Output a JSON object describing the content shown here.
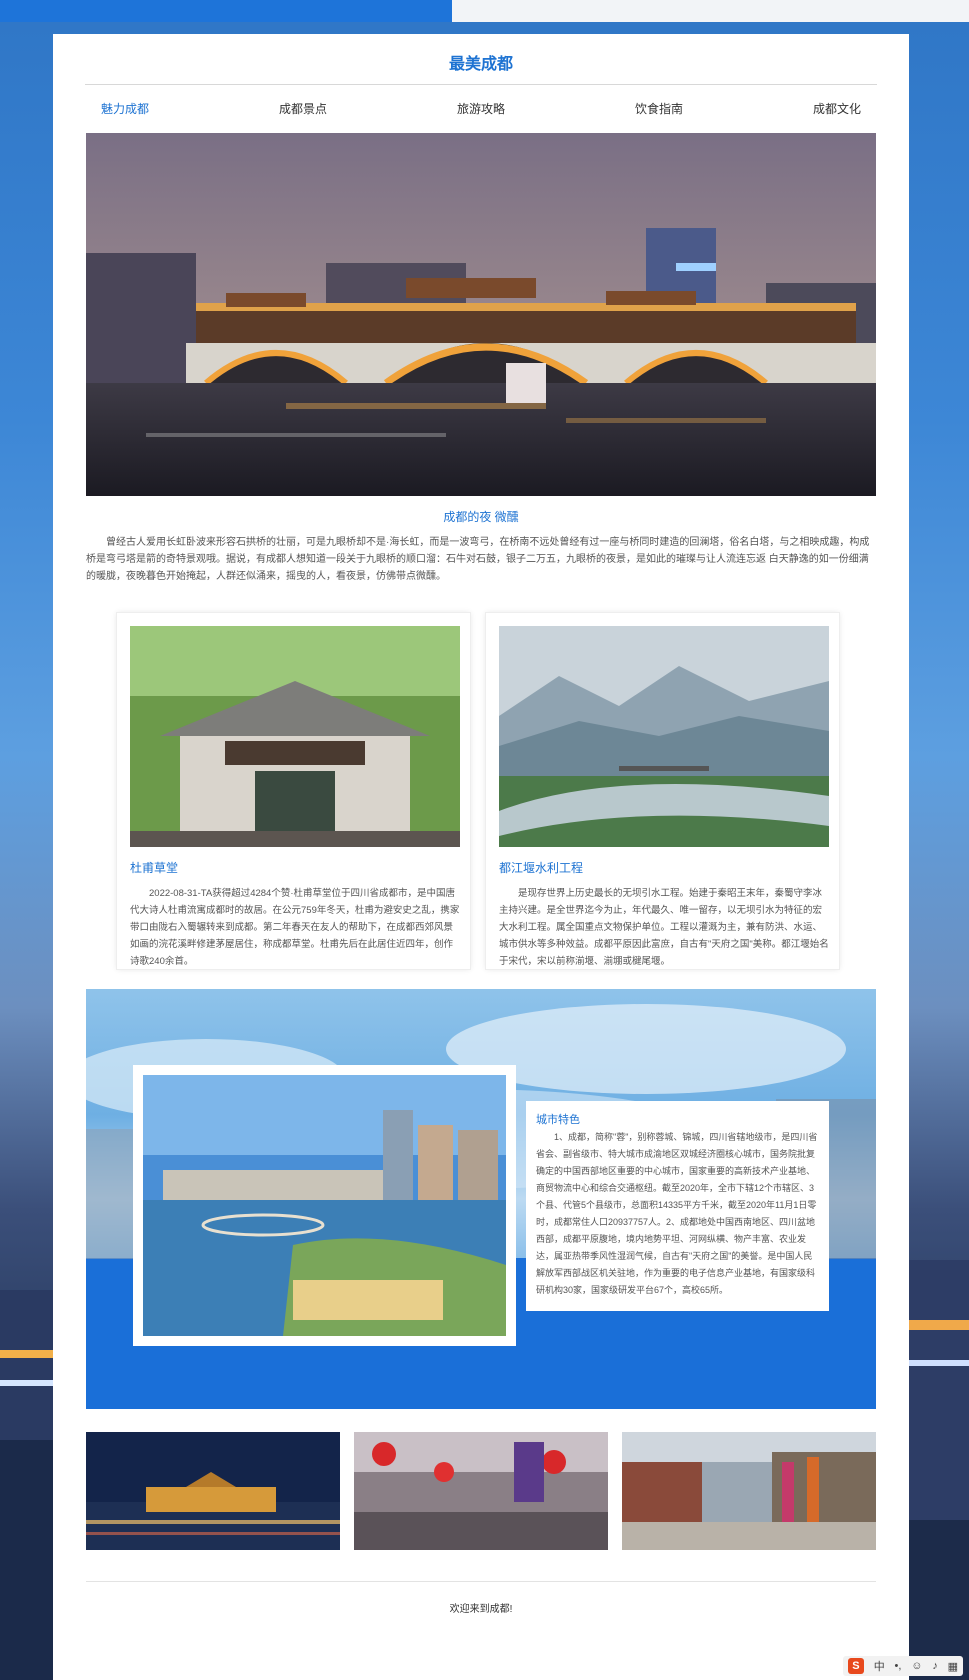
{
  "site": {
    "title": "最美成都"
  },
  "nav": {
    "items": [
      "魅力成都",
      "成都景点",
      "旅游攻略",
      "饮食指南",
      "成都文化"
    ]
  },
  "hero": {
    "caption": "成都的夜 微醺",
    "text": "曾经古人爱用长虹卧波来形容石拱桥的壮丽，可是九眼桥却不是·海长虹，而是一波弯弓，在桥南不远处曾经有过一座与桥同时建造的回澜塔，俗名白塔，与之相映成趣，构成桥是弯弓塔是箭的奇特景观哦。据说，有成都人想知道一段关于九眼桥的顺口溜：石牛对石鼓，银子二万五，九眼桥的夜景，是如此的璀璨与让人流连忘返 白天静逸的如一份细满的暖胧，夜晚暮色开始掩起，人群还似涌来，摇曳的人，看夜景，仿佛带点微醺。"
  },
  "cards": [
    {
      "title": "杜甫草堂",
      "text": "2022-08-31-TA获得超过4284个赞·杜甫草堂位于四川省成都市，是中国唐代大诗人杜甫流寓成都时的故居。在公元759年冬天，杜甫为避安史之乱，携家带口由陇右入蜀辗转来到成都。第二年春天在友人的帮助下，在成都西郊风景如画的浣花溪畔修建茅屋居住，称成都草堂。杜甫先后在此居住近四年，创作诗歌240余首。"
    },
    {
      "title": "都江堰水利工程",
      "text": "是现存世界上历史最长的无坝引水工程。始建于秦昭王末年，秦蜀守李冰主持兴建。是全世界迄今为止，年代最久、唯一留存，以无坝引水为特征的宏大水利工程。属全国重点文物保护单位。工程以灌溉为主，兼有防洪、水运、城市供水等多种效益。成都平原因此富庶，自古有\"天府之国\"美称。都江堰始名于宋代，宋以前称湔堰、湔堋或楗尾堰。"
    }
  ],
  "feature": {
    "title": "城市特色",
    "text": "1、成都，简称\"蓉\"，别称蓉城、锦城，四川省辖地级市，是四川省省会、副省级市、特大城市成渝地区双城经济圈核心城市，国务院批复确定的中国西部地区重要的中心城市，国家重要的高新技术产业基地、商贸物流中心和综合交通枢纽。截至2020年，全市下辖12个市辖区、3个县、代管5个县级市，总面积14335平方千米，截至2020年11月1日零时，成都常住人口20937757人。2、成都地处中国西南地区、四川盆地西部，成都平原腹地，境内地势平坦、河网纵横、物产丰富、农业发达，属亚热带季风性湿润气候，自古有\"天府之国\"的美誉。是中国人民解放军西部战区机关驻地，作为重要的电子信息产业基地，有国家级科研机构30家，国家级研发平台67个，高校65所。"
  },
  "footer": {
    "text": "欢迎来到成都!"
  },
  "colors": {
    "accent": "#1e73d2",
    "feature_band": "#1a6fd8"
  }
}
